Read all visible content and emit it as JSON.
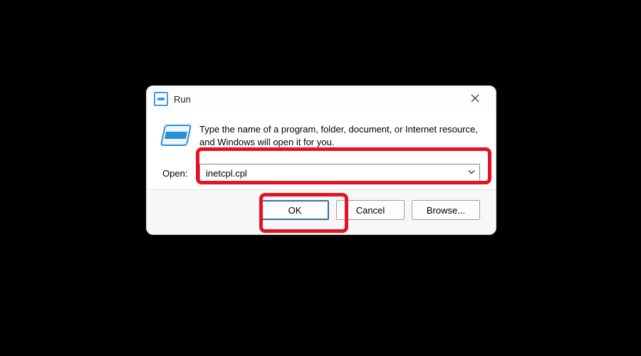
{
  "dialog": {
    "title": "Run",
    "description": "Type the name of a program, folder, document, or Internet resource, and Windows will open it for you.",
    "open_label": "Open:",
    "input_value": "inetcpl.cpl",
    "buttons": {
      "ok": "OK",
      "cancel": "Cancel",
      "browse": "Browse..."
    }
  }
}
